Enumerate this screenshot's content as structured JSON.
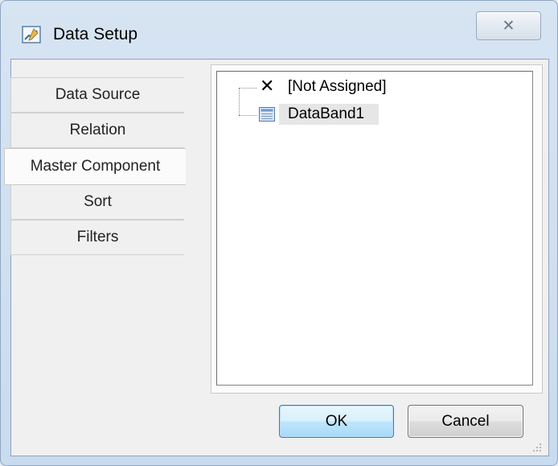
{
  "window": {
    "title": "Data Setup",
    "close_glyph": "✕",
    "icon": "chart-edit-icon"
  },
  "tabs": [
    {
      "label": "Data Source"
    },
    {
      "label": "Relation"
    },
    {
      "label": "Master Component",
      "active": true
    },
    {
      "label": "Sort"
    },
    {
      "label": "Filters"
    }
  ],
  "tree": {
    "items": [
      {
        "label": "[Not Assigned]",
        "icon": "x-icon"
      },
      {
        "label": "DataBand1",
        "icon": "databand-icon",
        "selected": true
      }
    ]
  },
  "buttons": {
    "ok": "OK",
    "cancel": "Cancel"
  },
  "colors": {
    "ok_border": "#3c7fb1",
    "frame": "#cfdff0"
  }
}
